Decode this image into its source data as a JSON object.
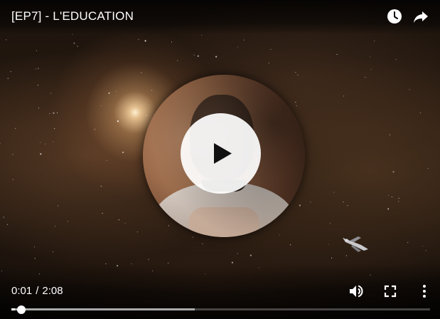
{
  "player": {
    "title": "[EP7] - L'EDUCATION",
    "current_time": "0:01",
    "separator": "/",
    "duration": "2:08",
    "played_fraction": 0.008,
    "buffered_fraction": 0.438
  },
  "icons": {
    "watch_later": "clock-icon",
    "share": "share-arrow-icon",
    "play": "play-icon",
    "volume": "volume-icon",
    "fullscreen": "fullscreen-icon",
    "more": "more-vertical-icon"
  },
  "colors": {
    "controls": "#ffffff",
    "play_button_bg": "#ffffff",
    "play_glyph": "#111111"
  }
}
